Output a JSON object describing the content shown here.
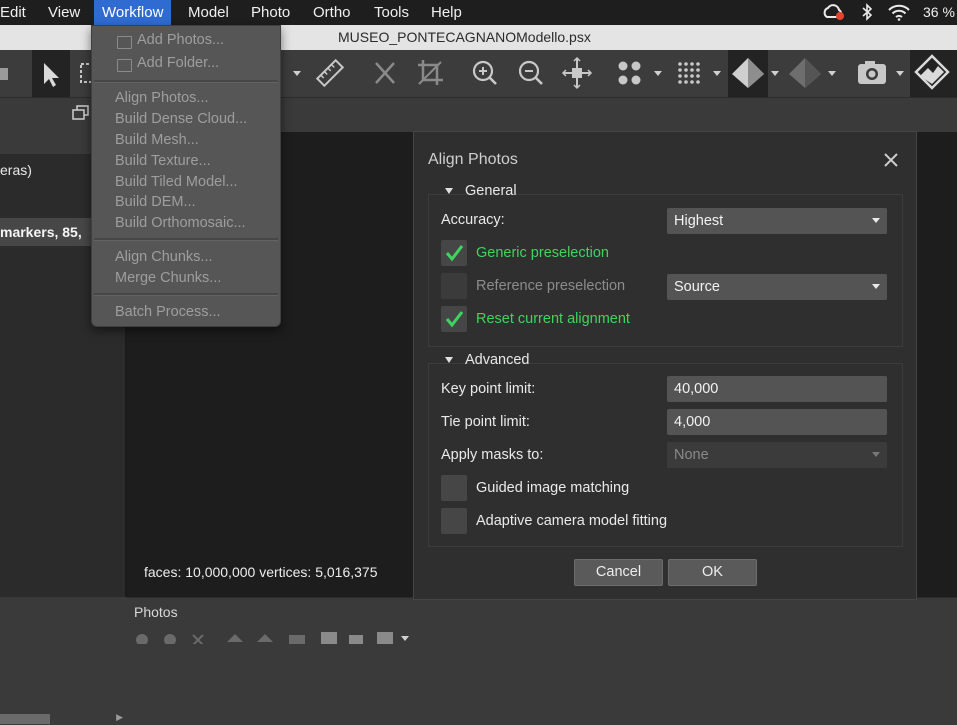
{
  "menubar": {
    "items": [
      "Edit",
      "View",
      "Workflow",
      "Model",
      "Photo",
      "Ortho",
      "Tools",
      "Help"
    ],
    "active": "Workflow",
    "battery": "36 %",
    "status_icons": [
      "creative-cloud-icon",
      "bluetooth-icon",
      "wifi-icon"
    ]
  },
  "window": {
    "title": "MUSEO_PONTECAGNANOModello.psx"
  },
  "left_panel": {
    "row1_text": "eras)",
    "row2_text": "markers, 85,"
  },
  "viewport": {
    "info": "faces: 10,000,000 vertices: 5,016,375"
  },
  "bottom_panel": {
    "label": "Photos"
  },
  "workflow_menu": {
    "items": [
      "Add Photos...",
      "Add Folder...",
      "Align Photos...",
      "Build Dense Cloud...",
      "Build Mesh...",
      "Build Texture...",
      "Build Tiled Model...",
      "Build DEM...",
      "Build Orthomosaic...",
      "Align Chunks...",
      "Merge Chunks...",
      "Batch Process..."
    ]
  },
  "dialog": {
    "title": "Align Photos",
    "general": {
      "heading": "General",
      "accuracy_label": "Accuracy:",
      "accuracy_value": "Highest",
      "generic_preselection": "Generic preselection",
      "reference_preselection": "Reference preselection",
      "reference_value": "Source",
      "reset_alignment": "Reset current alignment"
    },
    "advanced": {
      "heading": "Advanced",
      "key_point_label": "Key point limit:",
      "key_point_value": "40,000",
      "tie_point_label": "Tie point limit:",
      "tie_point_value": "4,000",
      "masks_label": "Apply masks to:",
      "masks_value": "None",
      "guided_matching": "Guided image matching",
      "adaptive_fitting": "Adaptive camera model fitting"
    },
    "cancel_label": "Cancel",
    "ok_label": "OK"
  }
}
